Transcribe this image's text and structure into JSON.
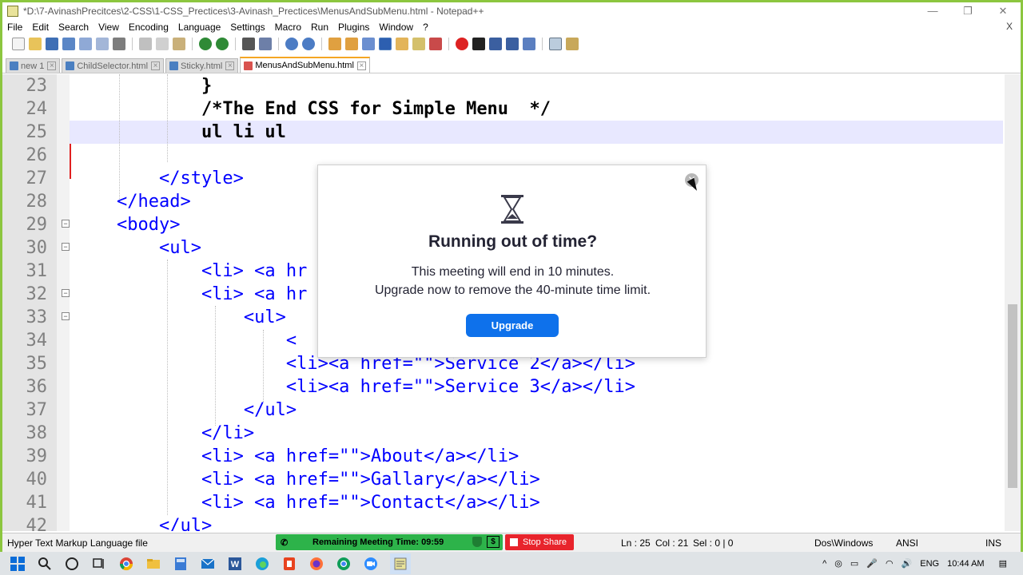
{
  "window": {
    "title": "*D:\\7-AvinashPrecitces\\2-CSS\\1-CSS_Prectices\\3-Avinash_Prectices\\MenusAndSubMenu.html - Notepad++",
    "minimize": "—",
    "maximize": "❐",
    "close": "✕"
  },
  "menubar": {
    "items": [
      "File",
      "Edit",
      "Search",
      "View",
      "Encoding",
      "Language",
      "Settings",
      "Macro",
      "Run",
      "Plugins",
      "Window",
      "?"
    ],
    "close_doc": "X"
  },
  "tabs": [
    {
      "label": "new 1",
      "active": false
    },
    {
      "label": "ChildSelector.html",
      "active": false
    },
    {
      "label": "Sticky.html",
      "active": false
    },
    {
      "label": "MenusAndSubMenu.html",
      "active": true
    }
  ],
  "editor": {
    "current_line": 25,
    "lines": [
      {
        "n": "23",
        "text": "            }"
      },
      {
        "n": "24",
        "text": "            /*The End CSS for Simple Menu  */"
      },
      {
        "n": "25",
        "text": "            ul li ul"
      },
      {
        "n": "26",
        "text": ""
      },
      {
        "n": "27",
        "text": "        </style>"
      },
      {
        "n": "28",
        "text": "    </head>"
      },
      {
        "n": "29",
        "text": "    <body>"
      },
      {
        "n": "30",
        "text": "        <ul>"
      },
      {
        "n": "31",
        "text": "            <li> <a hr"
      },
      {
        "n": "32",
        "text": "            <li> <a hr"
      },
      {
        "n": "33",
        "text": "                <ul>"
      },
      {
        "n": "34",
        "text": "                    <"
      },
      {
        "n": "35",
        "text": "                    <li><a href=\"\">Service 2</a></li>"
      },
      {
        "n": "36",
        "text": "                    <li><a href=\"\">Service 3</a></li>"
      },
      {
        "n": "37",
        "text": "                </ul>"
      },
      {
        "n": "38",
        "text": "            </li>"
      },
      {
        "n": "39",
        "text": "            <li> <a href=\"\">About</a></li>"
      },
      {
        "n": "40",
        "text": "            <li> <a href=\"\">Gallary</a></li>"
      },
      {
        "n": "41",
        "text": "            <li> <a href=\"\">Contact</a></li>"
      },
      {
        "n": "42",
        "text": "        </ul>"
      }
    ]
  },
  "statusbar": {
    "file_type": "Hyper Text Markup Language file",
    "ln": "Ln : 25",
    "col": "Col : 21",
    "sel": "Sel : 0 | 0",
    "eol": "Dos\\Windows",
    "encoding": "ANSI",
    "mode": "INS"
  },
  "zoom": {
    "timer_label": "Remaining Meeting Time: 09:59",
    "stop_share_label": "Stop Share",
    "dollar": "$"
  },
  "modal": {
    "title": "Running out of time?",
    "message_1": "This meeting will end in 10 minutes.",
    "message_2": "Upgrade now to remove the 40-minute time limit.",
    "button_label": "Upgrade",
    "close_symbol": "✕"
  },
  "taskbar": {
    "language": "ENG",
    "time": "10:44 AM"
  },
  "colors": {
    "frame_border": "#8cc63f",
    "current_line_bg": "#e8e8ff",
    "tag_blue": "#0000ff",
    "attr_red": "#cc0000",
    "string_purple": "#8000ff",
    "zoom_green": "#2db34a",
    "stop_share_red": "#e8242c",
    "upgrade_blue": "#0e71eb"
  }
}
